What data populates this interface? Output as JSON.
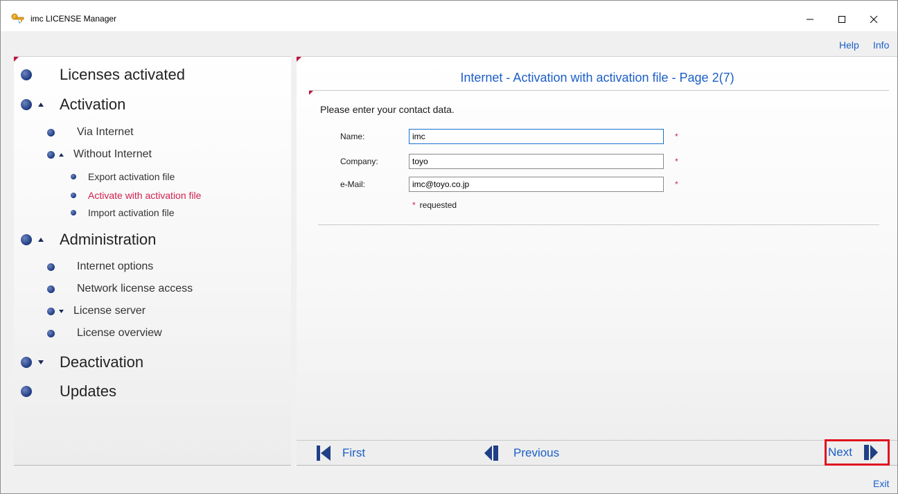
{
  "window": {
    "title": "imc LICENSE Manager",
    "controls": {
      "minimize": "minimize",
      "maximize": "maximize",
      "close": "close"
    }
  },
  "top_links": {
    "help": "Help",
    "info": "Info"
  },
  "nav": {
    "licenses_activated": "Licenses activated",
    "activation": "Activation",
    "via_internet": "Via Internet",
    "without_internet": "Without Internet",
    "export_activation_file": "Export activation file",
    "activate_with_activation_file": "Activate with activation file",
    "import_activation_file": "Import activation file",
    "administration": "Administration",
    "internet_options": "Internet options",
    "network_license_access": "Network license access",
    "license_server": "License server",
    "license_overview": "License overview",
    "deactivation": "Deactivation",
    "updates": "Updates"
  },
  "content": {
    "title": "Internet - Activation with activation file - Page 2(7)",
    "instruction": "Please enter your contact data.",
    "fields": {
      "name": {
        "label": "Name:",
        "value": "imc"
      },
      "company": {
        "label": "Company:",
        "value": "toyo"
      },
      "email": {
        "label": "e-Mail:",
        "value": "imc@toyo.co.jp"
      }
    },
    "required_star": "*",
    "required_legend": "requested"
  },
  "buttons": {
    "first": "First",
    "previous": "Previous",
    "next": "Next",
    "exit": "Exit"
  },
  "colors": {
    "link": "#1c5ec8",
    "active_item": "#d11f4e",
    "highlight_border": "#e0101f",
    "bullet": "#1d3a80"
  }
}
